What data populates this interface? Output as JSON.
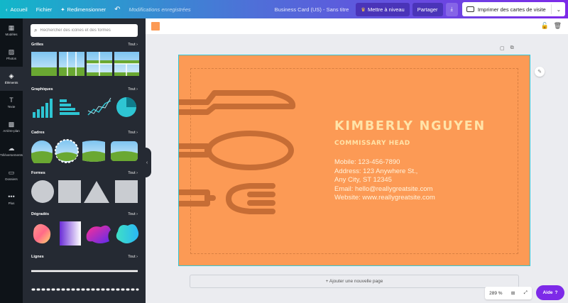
{
  "topbar": {
    "home": "Accueil",
    "file": "Fichier",
    "resize": "Redimensionner",
    "saved_status": "Modifications enregistrées",
    "doc_title": "Business Card (US) - Sans titre",
    "upgrade": "Mettre à niveau",
    "share": "Partager",
    "print": "Imprimer des cartes de visite"
  },
  "rail": {
    "items": [
      {
        "label": "Modèles",
        "icon": "templates-icon"
      },
      {
        "label": "Photos",
        "icon": "photos-icon"
      },
      {
        "label": "Éléments",
        "icon": "elements-icon"
      },
      {
        "label": "Texte",
        "icon": "text-icon"
      },
      {
        "label": "Arrière-plan",
        "icon": "background-icon"
      },
      {
        "label": "Téléversements",
        "icon": "upload-icon"
      },
      {
        "label": "Dossiers",
        "icon": "folder-icon"
      },
      {
        "label": "Plus",
        "icon": "more-icon"
      }
    ]
  },
  "panel": {
    "search_placeholder": "Rechercher des icônes et des formes",
    "see_all": "Tout",
    "sections": {
      "grids": "Grilles",
      "charts": "Graphiques",
      "frames": "Cadres",
      "shapes": "Formes",
      "gradients": "Dégradés",
      "lines": "Lignes"
    }
  },
  "card": {
    "name": "KIMBERLY NGUYEN",
    "role": "COMMISSARY HEAD",
    "mobile": "Mobile: 123-456-7890",
    "address1": "Address: 123 Anywhere St.,",
    "address2": "Any City, ST 12345",
    "email": "Email: hello@reallygreatsite.com",
    "website": "Website: www.reallygreatsite.com",
    "bg_color": "#fc9a55",
    "text_color": "#ffe3a8",
    "icon_color": "#c66d35"
  },
  "canvas": {
    "add_page": "+ Ajouter une nouvelle page",
    "zoom": "289 %",
    "help": "Aide"
  },
  "colors": {
    "accent": "#7d2ae8",
    "selection": "#2fc6d6"
  }
}
